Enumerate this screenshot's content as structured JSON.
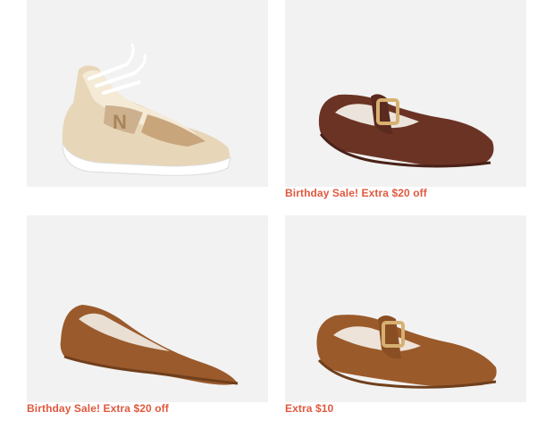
{
  "accent_color": "#e0593f",
  "products": [
    {
      "name": "gold-metallic-sneaker",
      "promo": ""
    },
    {
      "name": "brown-suede-mary-jane-flat",
      "promo": "Birthday Sale! Extra $20 off"
    },
    {
      "name": "cognac-suede-pointed-flat",
      "promo": "Birthday Sale! Extra $20 off"
    },
    {
      "name": "cognac-suede-mary-jane-flat",
      "promo": "Extra $10"
    }
  ]
}
